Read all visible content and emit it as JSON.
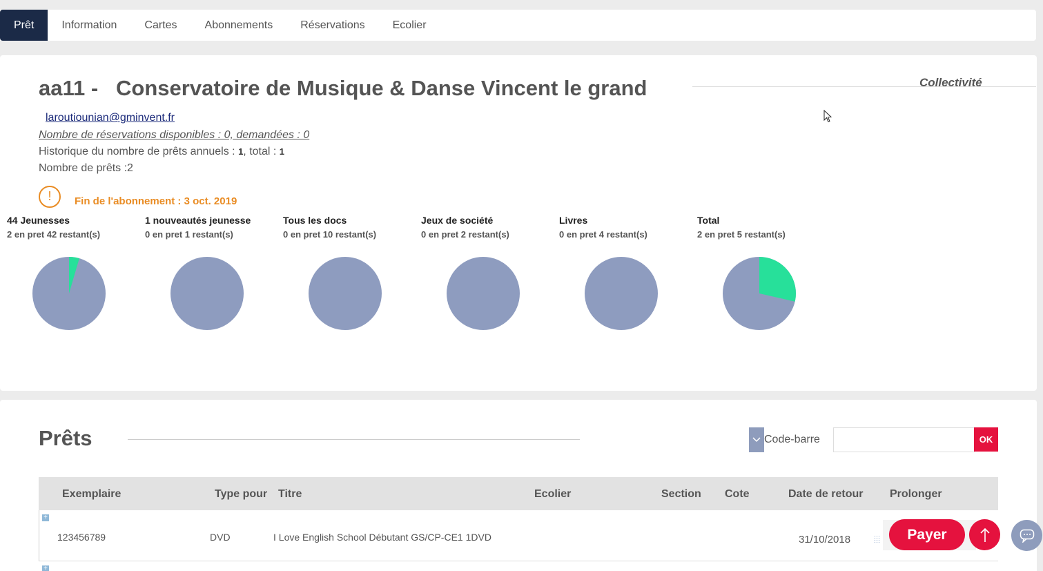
{
  "tabs": [
    {
      "label": "Prêt"
    },
    {
      "label": "Information"
    },
    {
      "label": "Cartes"
    },
    {
      "label": "Abonnements"
    },
    {
      "label": "Réservations"
    },
    {
      "label": "Ecolier"
    }
  ],
  "header": {
    "title": "aa11 -   Conservatoire de Musique & Danse Vincent le grand",
    "category": "Collectivité",
    "email": "laroutiounian@gminvent.fr",
    "reservations": "Nombre de réservations disponibles : 0, demandées : 0",
    "history_prefix": "Historique du nombre de prêts annuels : ",
    "history_annual": "1",
    "history_mid": ", total : ",
    "history_total": "1",
    "loans_count": "Nombre de prêts :2",
    "warning_icon": "exclamation-icon",
    "subscription_end": "Fin de l'abonnement : 3 oct. 2019"
  },
  "colors": {
    "pie_remaining": "#8e9cbf",
    "pie_loaned": "#27e09a",
    "accent": "#e5123e",
    "warning": "#e98c24",
    "nav_active": "#1b2a47"
  },
  "quotas": [
    {
      "label": "44 Jeunesses",
      "sub": "2 en pret 42 restant(s)",
      "loaned": 2,
      "remaining": 42
    },
    {
      "label": "1 nouveautés jeunesse",
      "sub": "0 en pret 1 restant(s)",
      "loaned": 0,
      "remaining": 1
    },
    {
      "label": "Tous les docs",
      "sub": "0 en pret 10 restant(s)",
      "loaned": 0,
      "remaining": 10
    },
    {
      "label": "Jeux de société",
      "sub": "0 en pret 2 restant(s)",
      "loaned": 0,
      "remaining": 2
    },
    {
      "label": "Livres",
      "sub": "0 en pret 4 restant(s)",
      "loaned": 0,
      "remaining": 4
    },
    {
      "label": "Total",
      "sub": "2 en pret 5 restant(s)",
      "loaned": 2,
      "remaining": 5
    }
  ],
  "loans": {
    "title": "Prêts",
    "search_mode": "Code-barre",
    "ok_label": "OK",
    "columns": [
      "Exemplaire",
      "Type pour",
      "Titre",
      "Ecolier",
      "Section",
      "Cote",
      "Date de retour",
      "Prolonger"
    ],
    "rows": [
      {
        "exemplaire": "123456789",
        "type": "DVD",
        "titre": "I Love English School Débutant GS/CP-CE1 1DVD",
        "ecolier": "",
        "section": "",
        "cote": "",
        "date_retour": "31/10/2018",
        "prolonger": ""
      }
    ]
  },
  "floating": {
    "pay_label": "Payer",
    "up_icon": "arrow-up-icon",
    "chat_icon": "chat-icon"
  }
}
